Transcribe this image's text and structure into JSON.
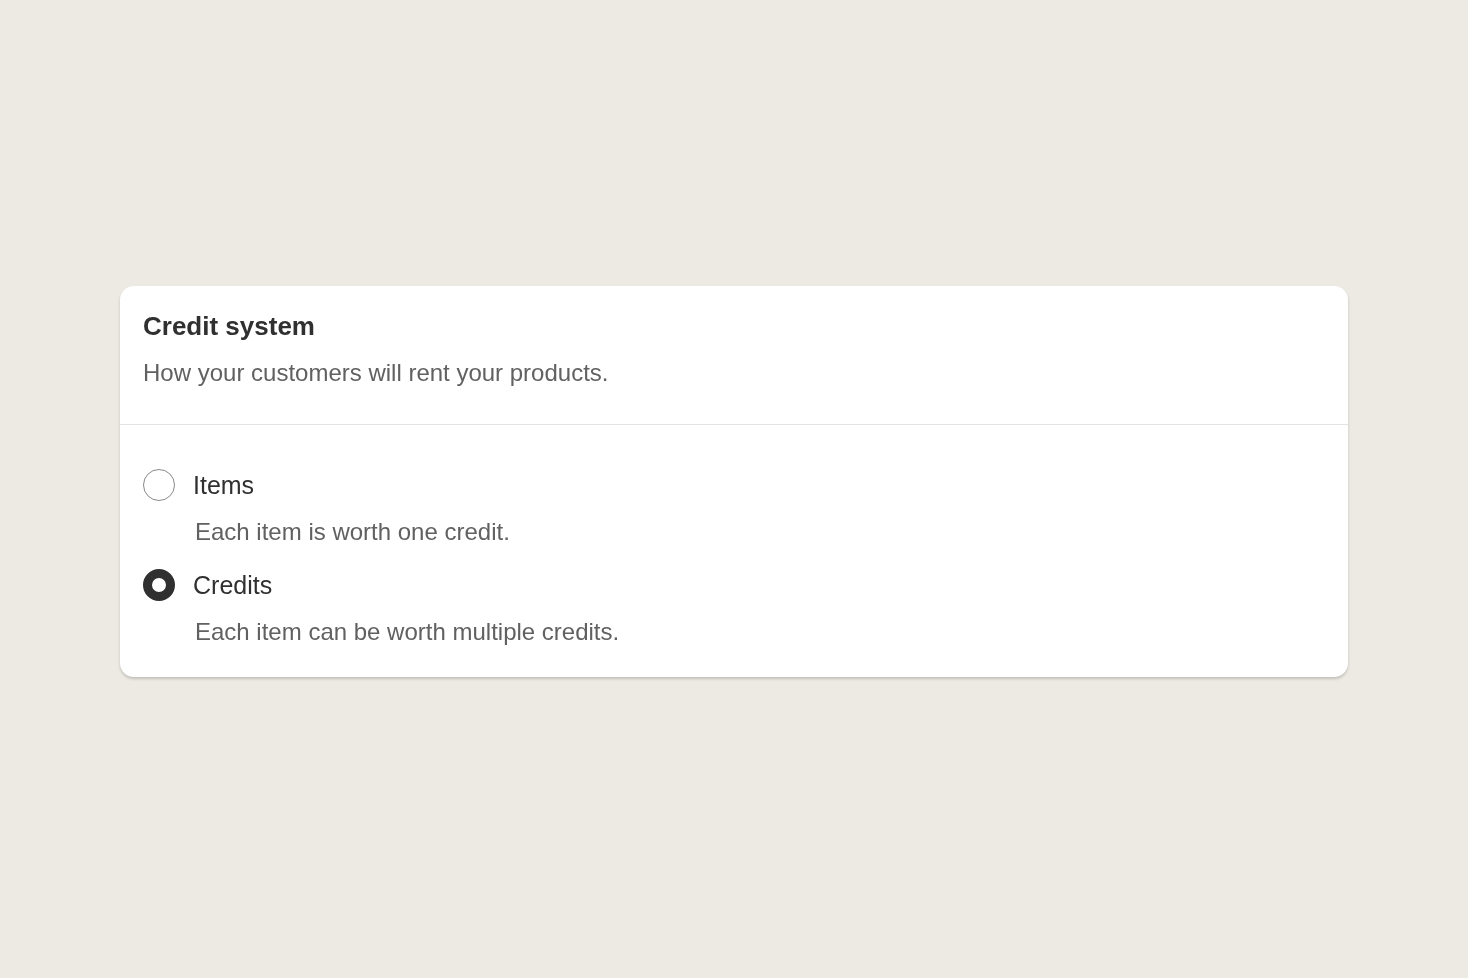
{
  "card": {
    "title": "Credit system",
    "description": "How your customers will rent your products."
  },
  "options": [
    {
      "label": "Items",
      "help": "Each item is worth one credit.",
      "selected": false
    },
    {
      "label": "Credits",
      "help": "Each item can be worth multiple credits.",
      "selected": true
    }
  ]
}
